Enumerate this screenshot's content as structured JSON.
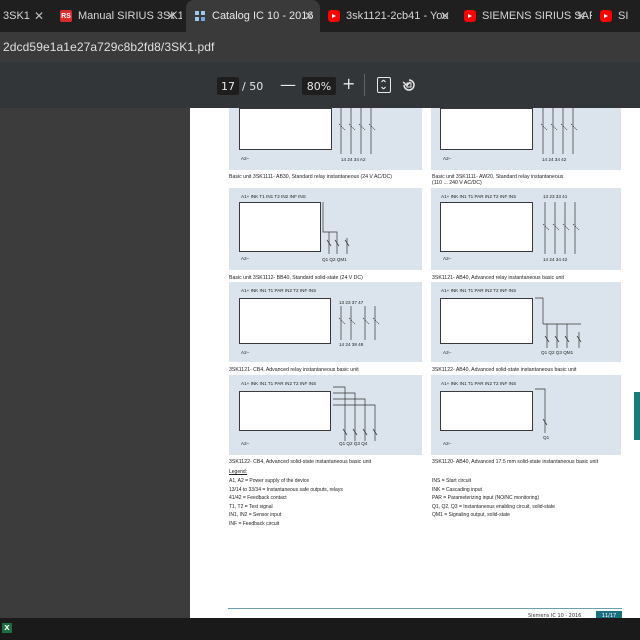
{
  "tabs": [
    {
      "label": "3SK1",
      "icon": "document-icon"
    },
    {
      "label": "Manual SIRIUS 3SK1",
      "icon": "rs-logo-icon"
    },
    {
      "label": "Catalog IC 10 - 2016",
      "icon": "pdf-doc-icon",
      "active": true
    },
    {
      "label": "3sk1121-2cb41 - You",
      "icon": "youtube-icon"
    },
    {
      "label": "SIEMENS SIRIUS SAF",
      "icon": "youtube-icon"
    },
    {
      "label": "SI",
      "icon": "youtube-icon"
    }
  ],
  "address": "2dcd59e1a1e27a729c8b2fd8/3SK1.pdf",
  "toolbar": {
    "page_current": "17",
    "page_total": "/ 50",
    "zoom_out": "—",
    "zoom": "80%",
    "zoom_in": "+"
  },
  "diagrams": {
    "d1": {
      "caption": "Basic unit 3SK1111- AB30, Standard relay instantaneous (24 V AC/DC)",
      "a2": "A2–",
      "terms": "14  24  34  A2"
    },
    "d2": {
      "caption": "Basic unit 3SK1111- AW20, Standard relay instantaneous",
      "caption2": "(110 ... 240 V AC/DC)",
      "a2": "A2–",
      "terms": "14  24  34  42"
    },
    "d3": {
      "caption": "Basic unit 3SK1112- BB40, Standard solid-state (24 V DC)",
      "top": "A1+ INK  T1  IN1  T2  IN2  INF  INS",
      "a2": "A2–",
      "terms": "Q1  Q2  QM1"
    },
    "d4": {
      "caption": "3SK1121- AB40, Advanced relay instantaneous basic unit",
      "top": "A1+ INK  IN1  T1  PAR  IN2  T2  INF  INS",
      "a2": "A2–",
      "terms": "13  23  33  41",
      "terms_bottom": "14  24  34  42"
    },
    "d5": {
      "caption": "3SK1121- CB4, Advanced relay instantaneous basic unit",
      "top": "A1+ INK  IN1  T1  PAR  IN2  T2  INF  INS",
      "a2": "A2–",
      "terms": "13  23  37  47",
      "terms_bottom": "14  24  38  48"
    },
    "d6": {
      "caption": "3SK1122- AB40, Advanced solid-state instantaneous basic unit",
      "top": "A1+ INK  IN1  T1  PAR  IN2  T2  INF  INS",
      "a2": "A2–",
      "terms": "Q1  Q2  Q3  QM1"
    },
    "d7": {
      "caption": "3SK1122- CB4, Advanced solid-state instantaneous basic unit",
      "top": "A1+ INK  IN1  T1  PAR  IN2  T2  INF  INS",
      "a2": "A2–",
      "terms": "Q1  Q2  Q3  Q4"
    },
    "d8": {
      "caption": "3SK1120- AB40, Advanced 17.5 mm solid-state instantaneous basic unit",
      "top": "A1+ INK  IN1  T1  PAR  IN2  T2  INF  INS",
      "a2": "A2–",
      "terms": "Q1"
    }
  },
  "legend": {
    "title": "Legend:",
    "left": [
      "A1, A2 = Power supply of the device",
      "13/14 to 33/34 = Instantaneous safe outputs, relays",
      "41/42 = Feedback contact",
      "T1, T2 = Test signal",
      "IN1, IN2 = Sensor input",
      "INF = Feedback circuit"
    ],
    "right": [
      "INS = Start circuit",
      "INK = Cascading input",
      "PAR = Parameterizing input (NO/NC monitoring)",
      "Q1, Q2, Q3 = Instantaneous enabling circuit, solid-state",
      "QM1 = Signaling output, solid-state"
    ]
  },
  "footer": {
    "text": "Siemens IC 10 · 2016",
    "page": "11/17"
  }
}
